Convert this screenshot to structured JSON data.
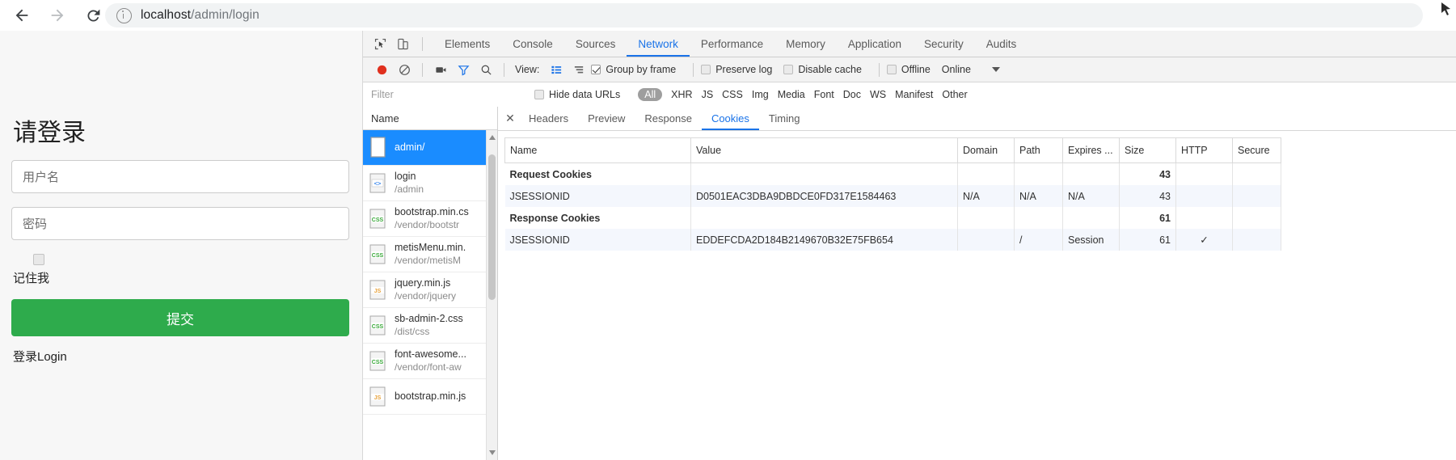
{
  "browser": {
    "back_icon": "arrow-left-icon",
    "forward_icon": "arrow-right-icon",
    "reload_icon": "reload-icon",
    "info_icon": "info-circle-icon",
    "url_host": "localhost",
    "url_path": "/admin/login",
    "corner_icon": "cursor-icon"
  },
  "login": {
    "title": "请登录",
    "username_placeholder": "用户名",
    "password_placeholder": "密码",
    "remember_label": "记住我",
    "submit_label": "提交",
    "login_link": "登录Login",
    "accent_color": "#2eab4c"
  },
  "devtools": {
    "inspect_icon": "inspect-element-icon",
    "device_icon": "device-toolbar-icon",
    "tabs": [
      {
        "label": "Elements",
        "active": false
      },
      {
        "label": "Console",
        "active": false
      },
      {
        "label": "Sources",
        "active": false
      },
      {
        "label": "Network",
        "active": true
      },
      {
        "label": "Performance",
        "active": false
      },
      {
        "label": "Memory",
        "active": false
      },
      {
        "label": "Application",
        "active": false
      },
      {
        "label": "Security",
        "active": false
      },
      {
        "label": "Audits",
        "active": false
      }
    ],
    "toolbar": {
      "record_icon": "record-button-icon",
      "clear_icon": "clear-icon",
      "capture_screenshots_icon": "camera-icon",
      "filter_icon": "funnel-icon",
      "search_icon": "search-icon",
      "view_label": "View:",
      "view_list_icon": "list-view-icon",
      "view_waterfall_icon": "waterfall-view-icon",
      "group_by_frame": {
        "label": "Group by frame",
        "checked": true
      },
      "preserve_log": {
        "label": "Preserve log",
        "checked": false
      },
      "disable_cache": {
        "label": "Disable cache",
        "checked": false
      },
      "offline": {
        "label": "Offline",
        "checked": false
      },
      "throttling": "Online",
      "throttling_caret_icon": "chevron-down-icon"
    },
    "filterbar": {
      "filter_placeholder": "Filter",
      "hide_data_urls": {
        "label": "Hide data URLs",
        "checked": false
      },
      "types": [
        "All",
        "XHR",
        "JS",
        "CSS",
        "Img",
        "Media",
        "Font",
        "Doc",
        "WS",
        "Manifest",
        "Other"
      ],
      "active_type": "All"
    },
    "requests": {
      "column_header": "Name",
      "items": [
        {
          "name": "admin/",
          "path": "",
          "kind": "doc",
          "selected": true
        },
        {
          "name": "login",
          "path": "/admin",
          "kind": "code",
          "selected": false
        },
        {
          "name": "bootstrap.min.cs",
          "path": "/vendor/bootstr",
          "kind": "css",
          "selected": false
        },
        {
          "name": "metisMenu.min.",
          "path": "/vendor/metisM",
          "kind": "css",
          "selected": false
        },
        {
          "name": "jquery.min.js",
          "path": "/vendor/jquery",
          "kind": "js",
          "selected": false
        },
        {
          "name": "sb-admin-2.css",
          "path": "/dist/css",
          "kind": "css",
          "selected": false
        },
        {
          "name": "font-awesome...",
          "path": "/vendor/font-aw",
          "kind": "css",
          "selected": false
        },
        {
          "name": "bootstrap.min.js",
          "path": "",
          "kind": "js",
          "selected": false
        }
      ]
    },
    "detail": {
      "close_icon": "close-icon",
      "tabs": [
        {
          "label": "Headers",
          "active": false
        },
        {
          "label": "Preview",
          "active": false
        },
        {
          "label": "Response",
          "active": false
        },
        {
          "label": "Cookies",
          "active": true
        },
        {
          "label": "Timing",
          "active": false
        }
      ],
      "cookies_table": {
        "columns": [
          "Name",
          "Value",
          "Domain",
          "Path",
          "Expires ...",
          "Size",
          "HTTP",
          "Secure"
        ],
        "rows": [
          {
            "group": true,
            "name": "Request Cookies",
            "value": "",
            "domain": "",
            "path": "",
            "expires": "",
            "size": "43",
            "http": "",
            "secure": ""
          },
          {
            "group": false,
            "name": "JSESSIONID",
            "value": "D0501EAC3DBA9DBDCE0FD317E1584463",
            "domain": "N/A",
            "path": "N/A",
            "expires": "N/A",
            "size": "43",
            "http": "",
            "secure": ""
          },
          {
            "group": true,
            "name": "Response Cookies",
            "value": "",
            "domain": "",
            "path": "",
            "expires": "",
            "size": "61",
            "http": "",
            "secure": ""
          },
          {
            "group": false,
            "name": "JSESSIONID",
            "value": "EDDEFCDA2D184B2149670B32E75FB654",
            "domain": "",
            "path": "/",
            "expires": "Session",
            "size": "61",
            "http": "✓",
            "secure": ""
          }
        ]
      }
    }
  }
}
